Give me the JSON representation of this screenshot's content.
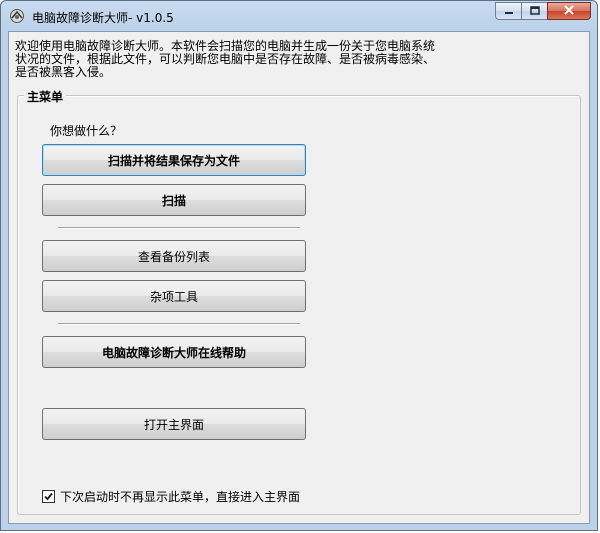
{
  "window": {
    "title": "电脑故障诊断大师- v1.0.5"
  },
  "intro": {
    "text": "欢迎使用电脑故障诊断大师。本软件会扫描您的电脑并生成一份关于您电脑系统状况的文件，根据此文件，可以判断您电脑中是否存在故障、是否被病毒感染、是否被黑客入侵。"
  },
  "main_menu": {
    "title": "主菜单",
    "question": "你想做什么？",
    "buttons": {
      "scan_save": "扫描并将结果保存为文件",
      "scan": "扫描",
      "view_backups": "查看备份列表",
      "misc_tools": "杂项工具",
      "online_help": "电脑故障诊断大师在线帮助",
      "open_main": "打开主界面"
    },
    "checkbox": {
      "label": "下次启动时不再显示此菜单，直接进入主界面",
      "checked": true
    }
  },
  "icons": {
    "app": "app-icon",
    "minimize": "minimize-icon",
    "maximize": "maximize-icon",
    "close": "close-icon",
    "check": "check-icon"
  }
}
